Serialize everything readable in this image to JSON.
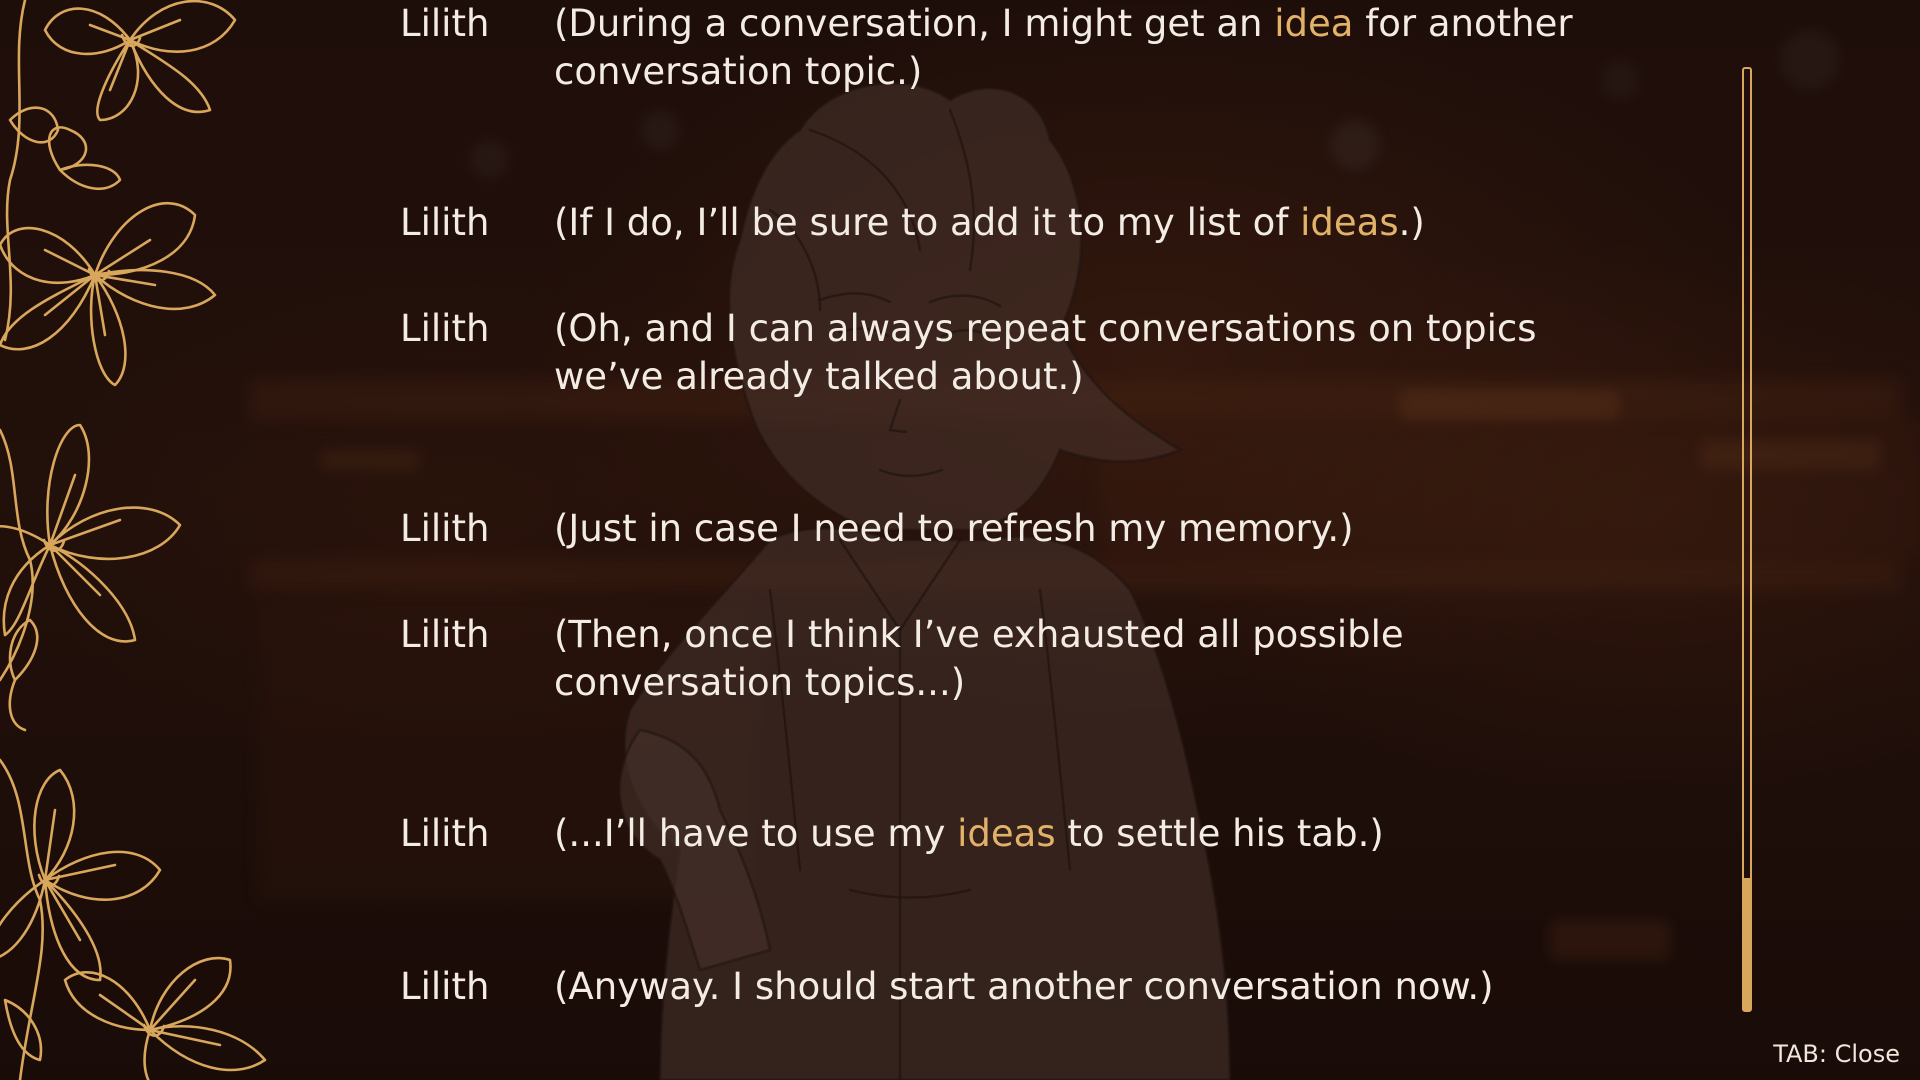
{
  "history": {
    "entries": [
      {
        "speaker": "Lilith",
        "parts": [
          "(During a conversation, I might get an ",
          "idea",
          " for another conversation topic.)"
        ]
      },
      {
        "speaker": "Lilith",
        "parts": [
          "(If I do, I’ll be sure to add it to my list of ",
          "ideas",
          ".)"
        ]
      },
      {
        "speaker": "Lilith",
        "parts": [
          "(Oh, and I can always repeat conversations on topics we’ve already talked about.)"
        ]
      },
      {
        "speaker": "Lilith",
        "parts": [
          "(Just in case I need to refresh my memory.)"
        ]
      },
      {
        "speaker": "Lilith",
        "parts": [
          "(Then, once I think I’ve exhausted all possible conversation topics...)"
        ]
      },
      {
        "speaker": "Lilith",
        "parts": [
          "(...I’ll have to use my ",
          "ideas",
          " to settle his tab.)"
        ]
      },
      {
        "speaker": "Lilith",
        "parts": [
          "(Anyway. I should start another conversation now.)"
        ]
      }
    ]
  },
  "footer": {
    "close_hint": "TAB: Close"
  },
  "scrollbar": {
    "position_fraction": 1.0,
    "visible_fraction": 0.14
  },
  "colors": {
    "text": "#f3ece4",
    "keyword": "#e2b268",
    "accent": "#d9a75c"
  },
  "icons": {
    "border": "gold-orchid-flower-border",
    "character": "character-sketch-silhouette"
  }
}
